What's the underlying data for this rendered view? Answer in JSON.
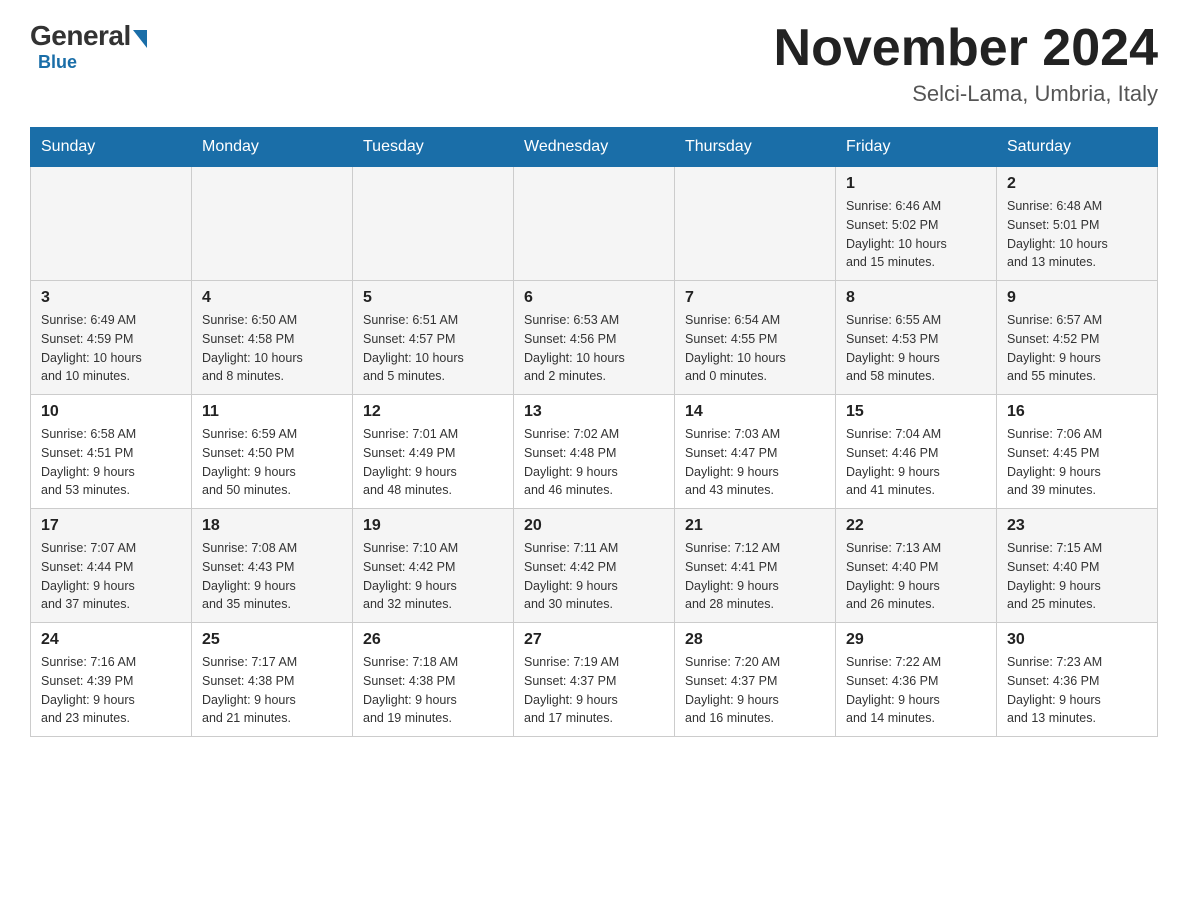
{
  "header": {
    "logo_general": "General",
    "logo_blue": "Blue",
    "month_title": "November 2024",
    "location": "Selci-Lama, Umbria, Italy"
  },
  "weekdays": [
    "Sunday",
    "Monday",
    "Tuesday",
    "Wednesday",
    "Thursday",
    "Friday",
    "Saturday"
  ],
  "weeks": [
    [
      {
        "day": "",
        "info": ""
      },
      {
        "day": "",
        "info": ""
      },
      {
        "day": "",
        "info": ""
      },
      {
        "day": "",
        "info": ""
      },
      {
        "day": "",
        "info": ""
      },
      {
        "day": "1",
        "info": "Sunrise: 6:46 AM\nSunset: 5:02 PM\nDaylight: 10 hours\nand 15 minutes."
      },
      {
        "day": "2",
        "info": "Sunrise: 6:48 AM\nSunset: 5:01 PM\nDaylight: 10 hours\nand 13 minutes."
      }
    ],
    [
      {
        "day": "3",
        "info": "Sunrise: 6:49 AM\nSunset: 4:59 PM\nDaylight: 10 hours\nand 10 minutes."
      },
      {
        "day": "4",
        "info": "Sunrise: 6:50 AM\nSunset: 4:58 PM\nDaylight: 10 hours\nand 8 minutes."
      },
      {
        "day": "5",
        "info": "Sunrise: 6:51 AM\nSunset: 4:57 PM\nDaylight: 10 hours\nand 5 minutes."
      },
      {
        "day": "6",
        "info": "Sunrise: 6:53 AM\nSunset: 4:56 PM\nDaylight: 10 hours\nand 2 minutes."
      },
      {
        "day": "7",
        "info": "Sunrise: 6:54 AM\nSunset: 4:55 PM\nDaylight: 10 hours\nand 0 minutes."
      },
      {
        "day": "8",
        "info": "Sunrise: 6:55 AM\nSunset: 4:53 PM\nDaylight: 9 hours\nand 58 minutes."
      },
      {
        "day": "9",
        "info": "Sunrise: 6:57 AM\nSunset: 4:52 PM\nDaylight: 9 hours\nand 55 minutes."
      }
    ],
    [
      {
        "day": "10",
        "info": "Sunrise: 6:58 AM\nSunset: 4:51 PM\nDaylight: 9 hours\nand 53 minutes."
      },
      {
        "day": "11",
        "info": "Sunrise: 6:59 AM\nSunset: 4:50 PM\nDaylight: 9 hours\nand 50 minutes."
      },
      {
        "day": "12",
        "info": "Sunrise: 7:01 AM\nSunset: 4:49 PM\nDaylight: 9 hours\nand 48 minutes."
      },
      {
        "day": "13",
        "info": "Sunrise: 7:02 AM\nSunset: 4:48 PM\nDaylight: 9 hours\nand 46 minutes."
      },
      {
        "day": "14",
        "info": "Sunrise: 7:03 AM\nSunset: 4:47 PM\nDaylight: 9 hours\nand 43 minutes."
      },
      {
        "day": "15",
        "info": "Sunrise: 7:04 AM\nSunset: 4:46 PM\nDaylight: 9 hours\nand 41 minutes."
      },
      {
        "day": "16",
        "info": "Sunrise: 7:06 AM\nSunset: 4:45 PM\nDaylight: 9 hours\nand 39 minutes."
      }
    ],
    [
      {
        "day": "17",
        "info": "Sunrise: 7:07 AM\nSunset: 4:44 PM\nDaylight: 9 hours\nand 37 minutes."
      },
      {
        "day": "18",
        "info": "Sunrise: 7:08 AM\nSunset: 4:43 PM\nDaylight: 9 hours\nand 35 minutes."
      },
      {
        "day": "19",
        "info": "Sunrise: 7:10 AM\nSunset: 4:42 PM\nDaylight: 9 hours\nand 32 minutes."
      },
      {
        "day": "20",
        "info": "Sunrise: 7:11 AM\nSunset: 4:42 PM\nDaylight: 9 hours\nand 30 minutes."
      },
      {
        "day": "21",
        "info": "Sunrise: 7:12 AM\nSunset: 4:41 PM\nDaylight: 9 hours\nand 28 minutes."
      },
      {
        "day": "22",
        "info": "Sunrise: 7:13 AM\nSunset: 4:40 PM\nDaylight: 9 hours\nand 26 minutes."
      },
      {
        "day": "23",
        "info": "Sunrise: 7:15 AM\nSunset: 4:40 PM\nDaylight: 9 hours\nand 25 minutes."
      }
    ],
    [
      {
        "day": "24",
        "info": "Sunrise: 7:16 AM\nSunset: 4:39 PM\nDaylight: 9 hours\nand 23 minutes."
      },
      {
        "day": "25",
        "info": "Sunrise: 7:17 AM\nSunset: 4:38 PM\nDaylight: 9 hours\nand 21 minutes."
      },
      {
        "day": "26",
        "info": "Sunrise: 7:18 AM\nSunset: 4:38 PM\nDaylight: 9 hours\nand 19 minutes."
      },
      {
        "day": "27",
        "info": "Sunrise: 7:19 AM\nSunset: 4:37 PM\nDaylight: 9 hours\nand 17 minutes."
      },
      {
        "day": "28",
        "info": "Sunrise: 7:20 AM\nSunset: 4:37 PM\nDaylight: 9 hours\nand 16 minutes."
      },
      {
        "day": "29",
        "info": "Sunrise: 7:22 AM\nSunset: 4:36 PM\nDaylight: 9 hours\nand 14 minutes."
      },
      {
        "day": "30",
        "info": "Sunrise: 7:23 AM\nSunset: 4:36 PM\nDaylight: 9 hours\nand 13 minutes."
      }
    ]
  ]
}
